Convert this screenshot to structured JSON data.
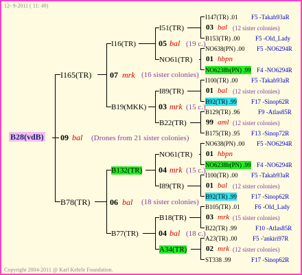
{
  "header": {
    "date": "12-  9-2011 ( 11: 49)"
  },
  "footer": {
    "copyright": "Copyright 2004-2011 @ Karl Kehrle Foundation."
  },
  "root": {
    "code": "B28(vdB)",
    "num": "09",
    "name": "bal",
    "note": "(Drones from 21 sister colonies)"
  },
  "gen1": {
    "top": {
      "code": "I165(TR)",
      "num": "07",
      "name": "mrk",
      "note": "(16 sister colonies)"
    },
    "bottom": {
      "code": "B78(TR)",
      "num": "06",
      "name": "bal",
      "note": "(18 sister colonies)"
    }
  },
  "gen2": {
    "a": {
      "code": "I16(TR)",
      "num": "05",
      "name": "bal",
      "note": "(19 c.)"
    },
    "b": {
      "code": "B19(MKK)",
      "num": "03",
      "name": "mrk",
      "note": "(15 c.)"
    },
    "c": {
      "code": "B132(TR)",
      "num": "04",
      "name": "mrk",
      "note": "(15 c.)"
    },
    "d": {
      "code": "B77(TR)",
      "num": "04",
      "name": "bal",
      "note": "(18 c.)"
    }
  },
  "gen3": {
    "a1": "I51(TR)",
    "a2": "NO61(TR)",
    "b1": "I89(TR)",
    "b2": "B22(TR)",
    "c1": "NO61(TR)",
    "c2": "I89(TR)",
    "d1": "B18(TR)",
    "d2": "A34(TR)"
  },
  "gen4": [
    {
      "top": "I147(TR) .01",
      "top_ref": "F5 -Takab93aR",
      "num": "03",
      "name": "bal",
      "note": "(12 sister colonies)",
      "bot": "B153(TR) .00",
      "bot_ref": "F5 -Old_Lady"
    },
    {
      "top": "NO638(PN) .00",
      "top_ref": "F5 -NO6294R",
      "num": "01",
      "name": "hbpn",
      "note": "",
      "bot": "NO6238b(PN) .99",
      "bot_ref": "F4 -NO6294R"
    },
    {
      "top": "I100(TR) .00",
      "top_ref": "F5 -Takab93aR",
      "num": "01",
      "name": "bal",
      "note": "(12 sister colonies)",
      "bot": "B92(TR) .99",
      "bot_ref": "F17 -Sinop62R"
    },
    {
      "top": "B129(TR) .96",
      "top_ref": "F9 -Atlas85R",
      "num": "99",
      "name": "aml",
      "note": "(12 sister colonies)",
      "bot": "B175(TR) .95",
      "bot_ref": "F13 -Sinop72R"
    },
    {
      "top": "NO638(PN) .00",
      "top_ref": "F5 -NO6294R",
      "num": "01",
      "name": "hbpn",
      "note": "",
      "bot": "NO6238b(PN) .99",
      "bot_ref": "F4 -NO6294R"
    },
    {
      "top": "I100(TR) .00",
      "top_ref": "F5 -Takab93aR",
      "num": "01",
      "name": "bal",
      "note": "(12 sister colonies)",
      "bot": "B92(TR) .99",
      "bot_ref": "F17 -Sinop62R"
    },
    {
      "top": "B105(TR) .01",
      "top_ref": "F6 -Old_Lady",
      "num": "03",
      "name": "mrk",
      "note": "(15 sister colonies)",
      "bot": "B22(TR) .99",
      "bot_ref": "F10 -Atlas85R"
    },
    {
      "top": "A23(TR) .00",
      "top_ref": "F5 -'ankiri97R",
      "num": "02",
      "name": "mrk",
      "note": "(12 sister colonies)",
      "bot": "ST338 .99",
      "bot_ref": "F17 -Sinop62R"
    }
  ]
}
